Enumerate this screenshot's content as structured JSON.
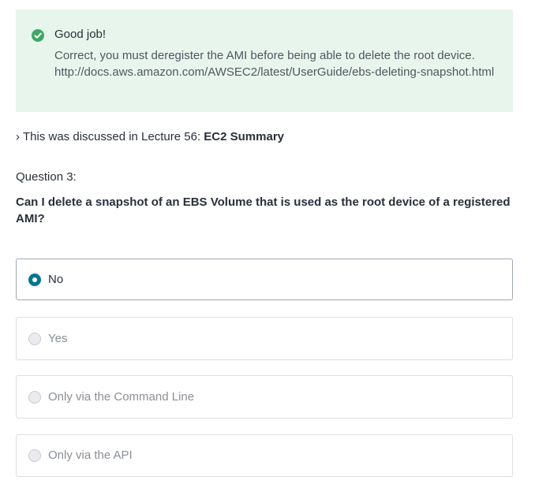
{
  "feedback": {
    "icon": "check-circle-icon",
    "accent_color": "#3ea865",
    "background_color": "#e8f5ec",
    "title": "Good job!",
    "body": "Correct, you must deregister the AMI before being able to delete the root device. http://docs.aws.amazon.com/AWSEC2/latest/UserGuide/ebs-deleting-snapshot.html"
  },
  "lecture_ref": {
    "chevron": "›",
    "prefix": "This was discussed in Lecture 56:",
    "lecture_name": "EC2 Summary"
  },
  "question": {
    "label": "Question 3:",
    "text": "Can I delete a snapshot of an EBS Volume that is used as the root device of a registered AMI?"
  },
  "options": [
    {
      "label": "No",
      "selected": true
    },
    {
      "label": "Yes",
      "selected": false
    },
    {
      "label": "Only via the Command Line",
      "selected": false
    },
    {
      "label": "Only via the API",
      "selected": false
    }
  ],
  "selected_color": "#007791"
}
